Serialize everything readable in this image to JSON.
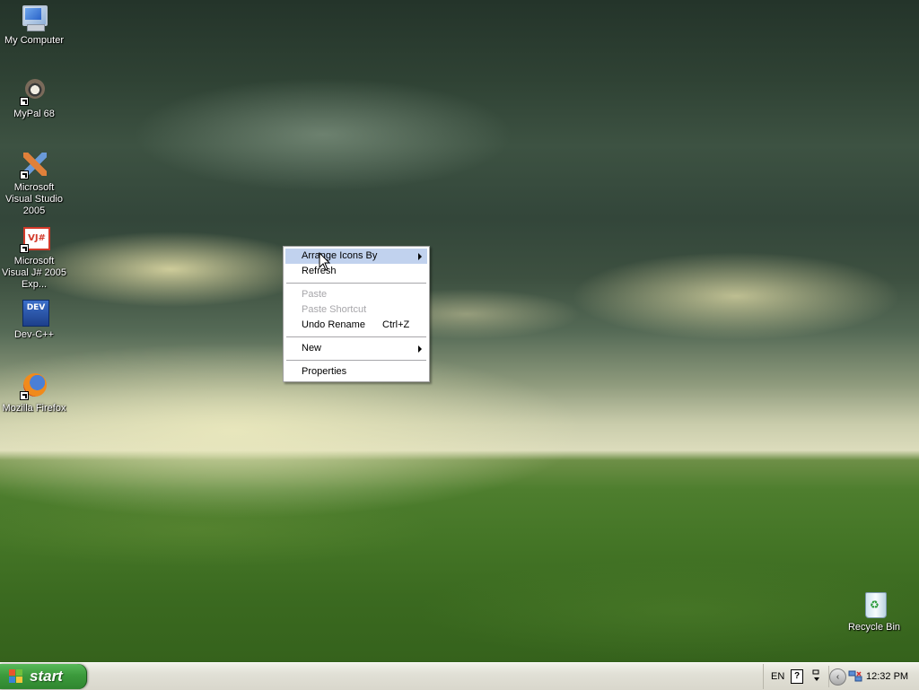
{
  "desktop": {
    "icons": [
      {
        "label": "My Computer",
        "icon": "my-computer-icon"
      },
      {
        "label": "MyPal 68",
        "icon": "mypal-icon"
      },
      {
        "label": "Microsoft Visual Studio 2005",
        "icon": "visual-studio-icon"
      },
      {
        "label": "Microsoft Visual J# 2005 Exp...",
        "icon": "visual-jsharp-icon",
        "icon_text": "VJ#"
      },
      {
        "label": "Dev-C++",
        "icon": "dev-cpp-icon",
        "icon_text": "DEV"
      },
      {
        "label": "Mozilla Firefox",
        "icon": "firefox-icon"
      },
      {
        "label": "Recycle Bin",
        "icon": "recycle-bin-icon"
      }
    ]
  },
  "context_menu": {
    "items": [
      {
        "label": "Arrange Icons By",
        "submenu": true,
        "highlighted": true
      },
      {
        "label": "Refresh"
      },
      {
        "label": "Paste",
        "disabled": true
      },
      {
        "label": "Paste Shortcut",
        "disabled": true
      },
      {
        "label": "Undo Rename",
        "accelerator": "Ctrl+Z"
      },
      {
        "label": "New",
        "submenu": true
      },
      {
        "label": "Properties"
      }
    ]
  },
  "taskbar": {
    "start_label": "start",
    "tray": {
      "language": "EN",
      "help_glyph": "?",
      "time": "12:32 PM"
    }
  },
  "colors": {
    "menu_highlight": "#c1d2ee",
    "start_green": "#3c9a3c",
    "taskbar": "#e1e0d6",
    "disabled_text": "#a7a6aa"
  }
}
